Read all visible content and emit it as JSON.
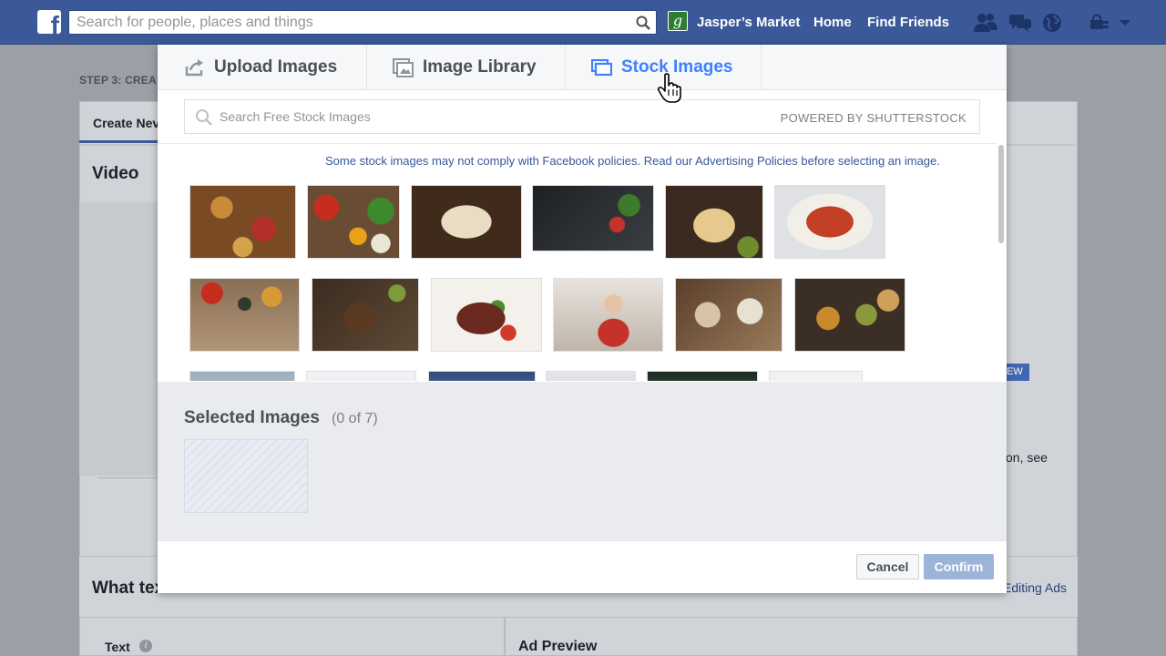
{
  "topbar": {
    "search_placeholder": "Search for people, places and things",
    "avatar_letter": "g",
    "profile_name": "Jasper’s Market",
    "home": "Home",
    "find_friends": "Find Friends",
    "brand_color": "#3b5998"
  },
  "background": {
    "step_label": "STEP 3: CREA",
    "tab_create": "Create Nev",
    "section_video": "Video",
    "badge_new": "EW",
    "text_fragment": "on, see",
    "section_text_links": "What tex",
    "editing_ads": "Editing Ads",
    "text_label": "Text",
    "ad_preview": "Ad Preview"
  },
  "modal": {
    "tabs": [
      {
        "label": "Upload Images",
        "icon": "upload-icon",
        "active": false
      },
      {
        "label": "Image Library",
        "icon": "image-library-icon",
        "active": false
      },
      {
        "label": "Stock Images",
        "icon": "stock-images-icon",
        "active": true
      }
    ],
    "search_placeholder": "Search Free Stock Images",
    "powered_by": "POWERED BY SHUTTERSTOCK",
    "notice": "Some stock images may not comply with Facebook policies. Read our Advertising Policies before selecting an image.",
    "selected_title": "Selected Images",
    "selected_count": "(0 of 7)",
    "cancel": "Cancel",
    "confirm": "Confirm",
    "accent_color": "#4080ff"
  }
}
